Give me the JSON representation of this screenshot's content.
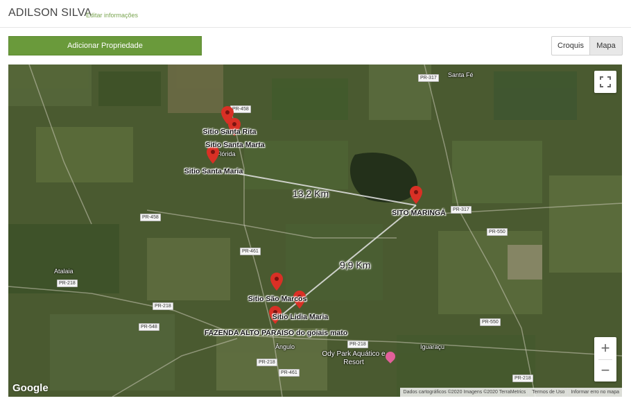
{
  "header": {
    "title": "ADILSON SILVA",
    "edit_link": "Editar informações"
  },
  "actions": {
    "add_property": "Adicionar Propriedade"
  },
  "view_toggle": {
    "croquis": "Croquis",
    "mapa": "Mapa",
    "selected": "Mapa"
  },
  "map": {
    "markers": [
      {
        "name": "Sitio Santa Rita"
      },
      {
        "name": "Sitio Santa Marta"
      },
      {
        "name": "Sitio Santa Maria"
      },
      {
        "name": "SITO MARINGÁ"
      },
      {
        "name": "Sitio São Marcos"
      },
      {
        "name": "Sitio Lidia Maria"
      },
      {
        "name": "FAZENDA ALTO PARAISO do goiais mato"
      }
    ],
    "distances": [
      {
        "label": "13,2 Km"
      },
      {
        "label": "9,9 Km"
      }
    ],
    "roads": [
      "PR-317",
      "PR-458",
      "PR-458",
      "PR-317",
      "PR-550",
      "PR-461",
      "PR-218",
      "PR-218",
      "PR-548",
      "PR-218",
      "PR-550",
      "PR-218",
      "PR-461",
      "PR-218"
    ],
    "towns": [
      "Santa Fé",
      "Flórida",
      "Atalaia",
      "Ângulo",
      "Iguaraçu"
    ],
    "poi": {
      "name": "Ody Park Aquático e Resort",
      "color": "#e2609a"
    },
    "marker_color": "#d93025",
    "google_logo": "Google",
    "attribution": {
      "data": "Dados cartográficos ©2020 Imagens ©2020 TerraMetrics",
      "terms": "Termos de Uso",
      "report": "Informar erro no mapa"
    },
    "zoom_in": "+",
    "zoom_out": "−"
  },
  "colors": {
    "primary_button": "#6a9a3b",
    "edit_link": "#7aa550"
  }
}
